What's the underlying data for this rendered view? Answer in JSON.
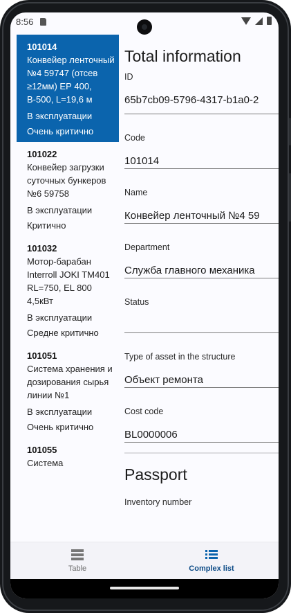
{
  "status_bar": {
    "time": "8:56"
  },
  "list": {
    "items": [
      {
        "code": "101014",
        "name": "Конвейер ленточный №4 59747 (отсев ≥12мм) ЕР 400, В-500, L=19,6 м",
        "status": "В эксплуатации",
        "criticality": "Очень критично",
        "selected": true
      },
      {
        "code": "101022",
        "name": "Конвейер загрузки суточных бункеров  №6 59758",
        "status": "В эксплуатации",
        "criticality": "Критично",
        "selected": false
      },
      {
        "code": "101032",
        "name": "Мотор-барабан Interroll JOKI TM401 RL=750, EL 800 4,5кВт",
        "status": "В эксплуатации",
        "criticality": "Средне критично",
        "selected": false
      },
      {
        "code": "101051",
        "name": "Система хранения и дозирования сырья линии №1",
        "status": "В эксплуатации",
        "criticality": "Очень критично",
        "selected": false
      },
      {
        "code": "101055",
        "name": "Система",
        "status": "",
        "criticality": "",
        "selected": false
      }
    ]
  },
  "detail": {
    "title": "Total information",
    "fields": {
      "id": {
        "label": "ID",
        "value": "65b7cb09-5796-4317-b1a0-2"
      },
      "code": {
        "label": "Code",
        "value": "101014"
      },
      "name": {
        "label": "Name",
        "value": "Конвейер ленточный №4 59"
      },
      "department": {
        "label": "Department",
        "value": "Служба главного механика"
      },
      "status": {
        "label": "Status",
        "value": ""
      },
      "asset_type": {
        "label": "Type of asset in the structure",
        "value": "Объект ремонта"
      },
      "cost_code": {
        "label": "Cost code",
        "value": "BL0000006"
      }
    },
    "passport": {
      "title": "Passport",
      "inventory_label": "Inventory number"
    }
  },
  "bottom_nav": {
    "table_label": "Table",
    "complex_list_label": "Complex list",
    "active": "Complex list"
  },
  "colors": {
    "accent": "#0b64ad",
    "active_nav": "#0b4a86"
  },
  "icons": {
    "table": "table-icon",
    "complex_list": "list-icon"
  }
}
